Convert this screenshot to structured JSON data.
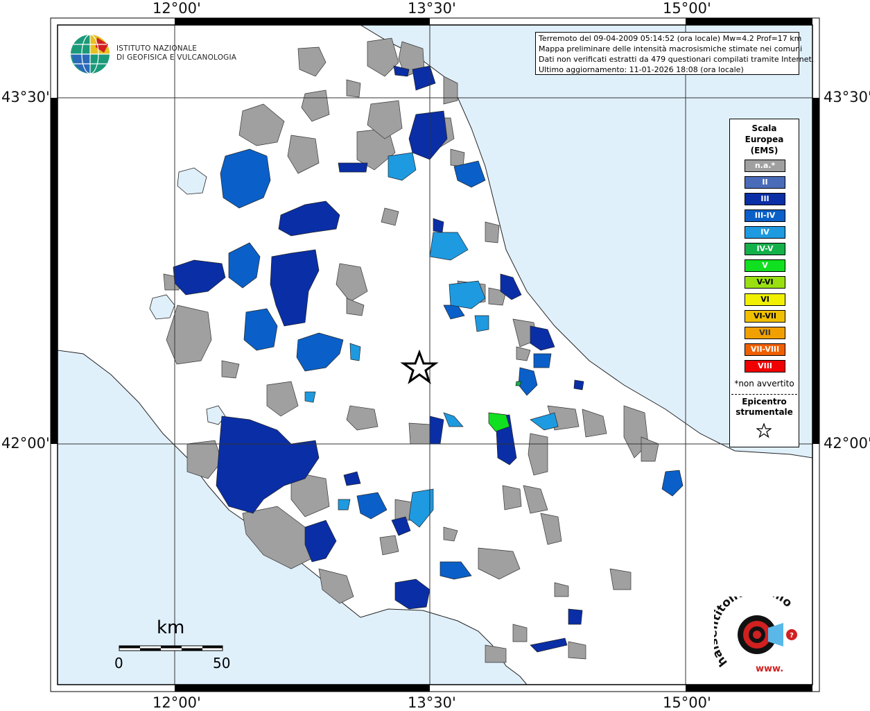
{
  "map": {
    "lon_labels": [
      "12°00'",
      "13°30'",
      "15°00'"
    ],
    "lat_labels": [
      "43°30'",
      "42°00'"
    ],
    "colors": {
      "sea": "#e0f0fb",
      "land": "#ffffff",
      "na": "#a0a0a0",
      "II": "#4a6bb8",
      "III": "#0a2ea6",
      "III-IV": "#0a60c8",
      "IV": "#1e9ae0"
    }
  },
  "info": {
    "line1": "Terremoto del 09-04-2009 05:14:52 (ora locale) Mw=4.2 Prof=17 km",
    "line2": "Mappa preliminare delle intensità macrosismiche stimate nei comuni",
    "line3": "Dati non verificati estratti da 479 questionari compilati tramite Internet.",
    "line4": "Ultimo aggiornamento: 11-01-2026 18:08 (ora locale)"
  },
  "logo": {
    "line1": "ISTITUTO NAZIONALE",
    "line2": "DI GEOFISICA E VULCANOLOGIA"
  },
  "legend": {
    "title1": "Scala",
    "title2": "Europea",
    "title3": "(EMS)",
    "items": [
      {
        "label": "n.a.*",
        "color": "#a0a0a0"
      },
      {
        "label": "II",
        "color": "#4a6bb8"
      },
      {
        "label": "III",
        "color": "#0a2ea6"
      },
      {
        "label": "III-IV",
        "color": "#0a60c8"
      },
      {
        "label": "IV",
        "color": "#1e9ae0"
      },
      {
        "label": "IV-V",
        "color": "#14b04a"
      },
      {
        "label": "V",
        "color": "#10e020"
      },
      {
        "label": "V-VI",
        "color": "#9ae010"
      },
      {
        "label": "VI",
        "color": "#f0f000"
      },
      {
        "label": "VI-VII",
        "color": "#f0c000"
      },
      {
        "label": "VII",
        "color": "#f0a000"
      },
      {
        "label": "VII-VIII",
        "color": "#f06000"
      },
      {
        "label": "VIII",
        "color": "#f00000"
      }
    ],
    "note": "*non avvertito",
    "epicenter1": "Epicentro",
    "epicenter2": "strumentale"
  },
  "scale": {
    "unit": "km",
    "start": "0",
    "end": "50"
  },
  "hsit": {
    "brand": "haisentitoilterremoto.it",
    "url": "www."
  }
}
